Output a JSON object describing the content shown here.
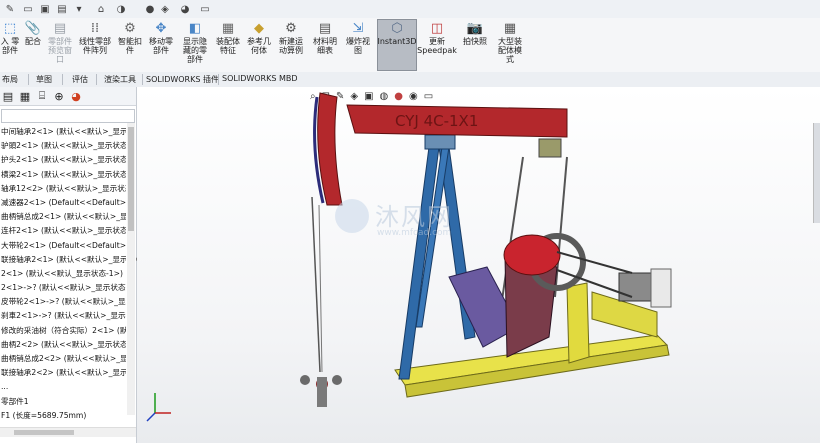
{
  "ribbon": {
    "buttons": [
      {
        "label": "入 零\n部件",
        "icon": "insert-part-icon"
      },
      {
        "label": "配合",
        "icon": "mate-icon"
      },
      {
        "label": "零部件\n预览窗\n口",
        "icon": "preview-window-icon"
      },
      {
        "label": "线性零部\n件阵列",
        "icon": "linear-pattern-icon"
      },
      {
        "label": "智能扣\n件",
        "icon": "smart-fastener-icon"
      },
      {
        "label": "移动零\n部件",
        "icon": "move-component-icon"
      },
      {
        "label": "显示隐\n藏的零\n部件",
        "icon": "show-hidden-icon"
      },
      {
        "label": "装配体\n特征",
        "icon": "assembly-feature-icon"
      },
      {
        "label": "参考几\n何体",
        "icon": "reference-geometry-icon"
      },
      {
        "label": "新建运\n动算例",
        "icon": "motion-study-icon"
      },
      {
        "label": "材料明\n细表",
        "icon": "bom-icon"
      },
      {
        "label": "爆炸视\n图",
        "icon": "exploded-view-icon"
      },
      {
        "label": "Instant3D",
        "icon": "instant3d-icon"
      },
      {
        "label": "更新\nSpeedpak",
        "icon": "speedpak-icon"
      },
      {
        "label": "拍快照",
        "icon": "snapshot-icon"
      },
      {
        "label": "大型装\n配体模\n式",
        "icon": "large-assembly-icon"
      }
    ]
  },
  "tabs": [
    "布局",
    "草图",
    "评估",
    "渲染工具",
    "SOLIDWORKS 插件",
    "SOLIDWORKS MBD"
  ],
  "tree": {
    "items": [
      "中间轴承2<1> (默认<<默认>_显示状",
      "驴頭2<1> (默认<<默认>_显示状态 1",
      "护头2<1> (默认<<默认>_显示状态 1",
      "横梁2<1> (默认<<默认>_显示状态 1",
      "轴承12<2> (默认<<默认>_显示状态",
      "减速器2<1> (Default<<Default>_显",
      "曲柄销总成2<1> (默认<<默认>_显示",
      "连杆2<1> (默认<<默认>_显示状态 1",
      "大带轮2<1> (Default<<Default>_显",
      "联接轴承2<1> (默认<<默认>_显示状",
      "2<1> (默认<<默认_显示状态-1>)",
      "2<1>->? (默认<<默认>_显示状态",
      "皮带轮2<1>->? (默认<<默认>_显示",
      "刹車2<1>->? (默认<<默认>_显示状",
      "修改的采油树（符合实际）2<1> (默认",
      "曲柄2<2> (默认<<默认>_显示状态 1",
      "曲柄销总成2<2> (默认<<默认>_显示",
      "联接轴承2<2> (默认<<默认>_显示状",
      "...",
      "零部件1",
      "F1 (长度=5689.75mm)"
    ]
  },
  "model": {
    "beam_text": "CYJ 4C-1X1",
    "watermark_title": "沐风网",
    "watermark_url": "www.mfcad.com"
  },
  "colors": {
    "beam": "#b3282c",
    "tower": "#2f6aa8",
    "base": "#e8e24a",
    "motor": "#c9242e",
    "gear": "#6a5aa0"
  }
}
